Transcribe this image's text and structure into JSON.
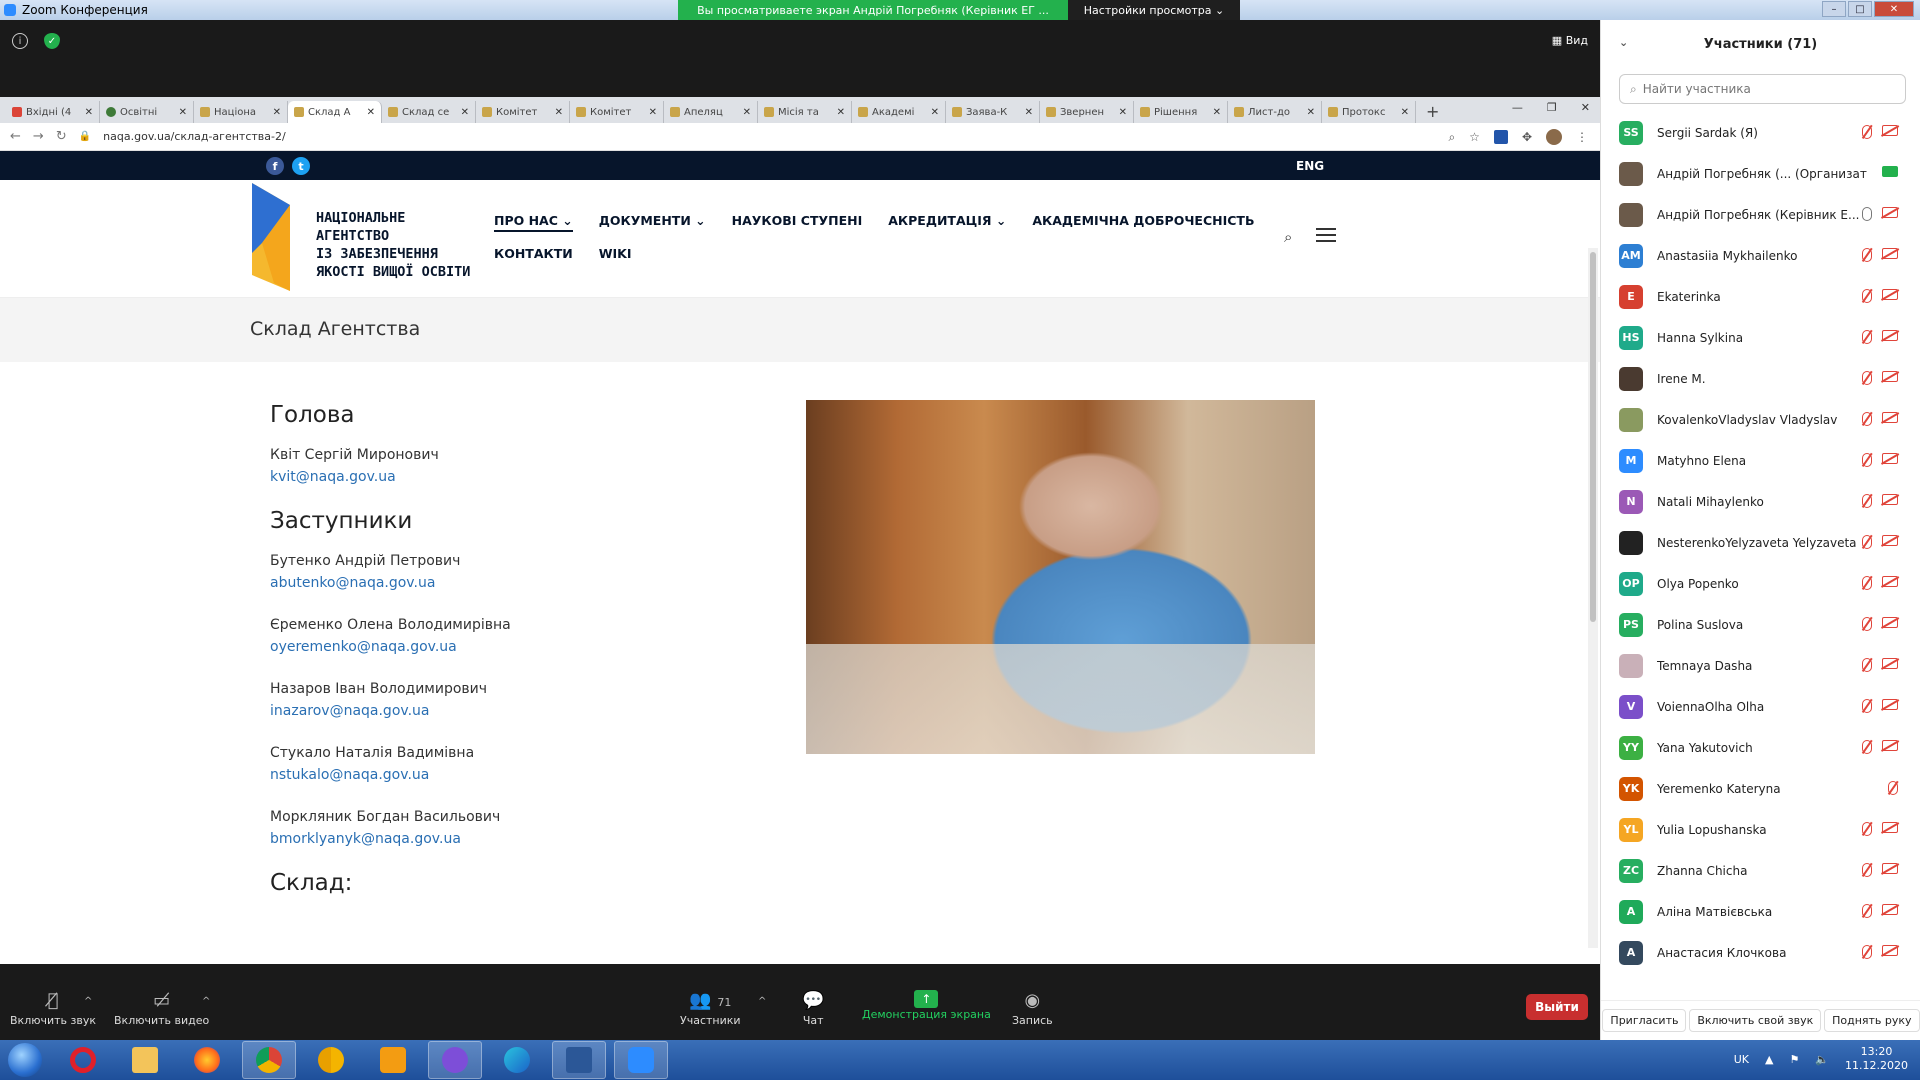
{
  "zoom": {
    "title": "Zoom Конференция",
    "share_banner": "Вы просматриваете экран Андрій Погребняк (Керівник ЕГ ...",
    "view_options": "Настройки просмотра",
    "view_label": "Вид"
  },
  "browser": {
    "tabs": [
      {
        "label": "Вхідні (4"
      },
      {
        "label": "Освітні"
      },
      {
        "label": "Націона"
      },
      {
        "label": "Склад А"
      },
      {
        "label": "Склад се"
      },
      {
        "label": "Комітет"
      },
      {
        "label": "Комітет"
      },
      {
        "label": "Апеляц"
      },
      {
        "label": "Місія та"
      },
      {
        "label": "Академі"
      },
      {
        "label": "Заява-К"
      },
      {
        "label": "Звернен"
      },
      {
        "label": "Рішення"
      },
      {
        "label": "Лист-до"
      },
      {
        "label": "Протокс"
      }
    ],
    "url": "naqa.gov.ua/склад-агентства-2/"
  },
  "site": {
    "eng": "ENG",
    "logo_lines": "НАЦІОНАЛЬНЕ\nАГЕНТСТВО\nІЗ ЗАБЕЗПЕЧЕННЯ\nЯКОСТІ ВИЩОЇ ОСВІТИ",
    "nav": [
      "ПРО НАС",
      "ДОКУМЕНТИ",
      "НАУКОВІ СТУПЕНІ",
      "АКРЕДИТАЦІЯ",
      "АКАДЕМІЧНА ДОБРОЧЕСНІСТЬ",
      "КОНТАКТИ",
      "WIKI"
    ],
    "page_title": "Склад Агентства",
    "head_title": "Голова",
    "head": {
      "name": "Квіт Сергій Миронович",
      "email": "kvit@naqa.gov.ua"
    },
    "deputies_title": "Заступники",
    "deputies": [
      {
        "name": "Бутенко Андрій Петрович",
        "email": "abutenko@naqa.gov.ua"
      },
      {
        "name": "Єременко Олена Володимирівна",
        "email": "oyeremenko@naqa.gov.ua"
      },
      {
        "name": "Назаров Іван Володимирович",
        "email": "inazarov@naqa.gov.ua"
      },
      {
        "name": "Стукало Наталія Вадимівна",
        "email": "nstukalo@naqa.gov.ua"
      },
      {
        "name": "Моркляник Богдан Васильович",
        "email": "bmorklyanyk@naqa.gov.ua"
      }
    ],
    "composition_title": "Склад:"
  },
  "toolbar": {
    "mute": "Включить звук",
    "video": "Включить видео",
    "participants": "Участники",
    "participants_count": "71",
    "chat": "Чат",
    "share": "Демонстрация экрана",
    "record": "Запись",
    "leave": "Выйти"
  },
  "panel": {
    "title": "Участники (71)",
    "search_placeholder": "Найти участника",
    "participants": [
      {
        "initials": "SS",
        "name": "Sergii Sardak (Я)",
        "color": "#27ae60"
      },
      {
        "initials": "",
        "name": "Андрій Погребняк (... (Организатор)",
        "color": "#6b5a4a"
      },
      {
        "initials": "",
        "name": "Андрій Погребняк (Керівник Е...",
        "color": "#6b5a4a"
      },
      {
        "initials": "AM",
        "name": "Anastasiia Mykhailenko",
        "color": "#2d7fd3"
      },
      {
        "initials": "E",
        "name": "Ekaterinka",
        "color": "#d64030"
      },
      {
        "initials": "HS",
        "name": "Hanna Sylkina",
        "color": "#1faa8a"
      },
      {
        "initials": "",
        "name": "Irene M.",
        "color": "#4a3a30"
      },
      {
        "initials": "",
        "name": "KovalenkoVladyslav Vladyslav",
        "color": "#8a9a60"
      },
      {
        "initials": "M",
        "name": "Matyhno Elena",
        "color": "#2d8cff"
      },
      {
        "initials": "N",
        "name": "Natali Mihaylenko",
        "color": "#9b59b6"
      },
      {
        "initials": "",
        "name": "NesterenkoYelyzaveta Yelyzaveta",
        "color": "#222222"
      },
      {
        "initials": "OP",
        "name": "Olya Popenko",
        "color": "#1faa8a"
      },
      {
        "initials": "PS",
        "name": "Polina Suslova",
        "color": "#27ae60"
      },
      {
        "initials": "",
        "name": "Temnaya Dasha",
        "color": "#c9b0b8"
      },
      {
        "initials": "V",
        "name": "VoiennaOlha Olha",
        "color": "#7b4fc9"
      },
      {
        "initials": "YY",
        "name": "Yana Yakutovich",
        "color": "#3cb043"
      },
      {
        "initials": "YK",
        "name": "Yeremenko Kateryna",
        "color": "#d35400"
      },
      {
        "initials": "YL",
        "name": "Yulia Lopushanska",
        "color": "#f5a623"
      },
      {
        "initials": "ZC",
        "name": "Zhanna Chicha",
        "color": "#27ae60"
      },
      {
        "initials": "A",
        "name": "Аліна Матвієвська",
        "color": "#1faa5a"
      },
      {
        "initials": "A",
        "name": "Анастасия Клочкова",
        "color": "#34495e"
      }
    ],
    "invite": "Пригласить",
    "unmute_me": "Включить свой звук",
    "raise_hand": "Поднять руку"
  },
  "taskbar": {
    "lang": "UK",
    "time": "13:20",
    "date": "11.12.2020"
  }
}
